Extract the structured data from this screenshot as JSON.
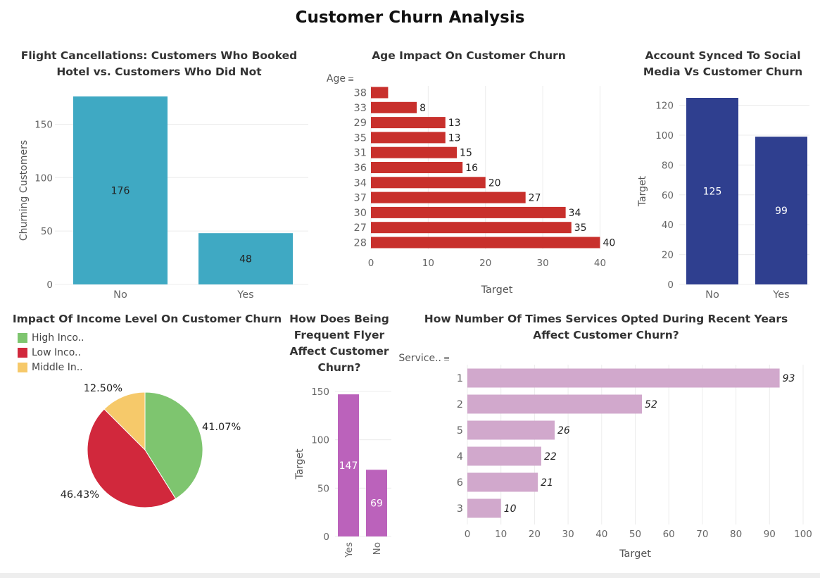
{
  "dashboard": {
    "title": "Customer Churn Analysis"
  },
  "colors": {
    "teal": "#3fa9c3",
    "red": "#c8302c",
    "navy": "#2f3f8f",
    "purple": "#bb62bb",
    "lilac": "#d1a8cc",
    "pie_green": "#7ec56f",
    "pie_red": "#d1283c",
    "pie_yellow": "#f6c96a",
    "grid": "#ececec"
  },
  "chart_data": [
    {
      "id": "hotel",
      "type": "bar",
      "title": "Flight Cancellations: Customers Who Booked Hotel vs. Customers Who Did Not",
      "xlabel": "",
      "ylabel": "Churning Customers",
      "categories": [
        "No",
        "Yes"
      ],
      "values": [
        176,
        48
      ],
      "value_labels": [
        "176",
        "48"
      ],
      "ylim": [
        0,
        176
      ],
      "yticks": [
        0,
        50,
        100,
        150
      ],
      "ytick_labels": [
        "0",
        "50",
        "100",
        "150"
      ],
      "grid": true
    },
    {
      "id": "age",
      "type": "bar",
      "orientation": "horizontal",
      "title": "Age Impact On Customer Churn",
      "ylabel": "Age",
      "xlabel": "Target",
      "categories": [
        "38",
        "33",
        "29",
        "35",
        "31",
        "36",
        "34",
        "37",
        "30",
        "27",
        "28"
      ],
      "values": [
        3,
        8,
        13,
        13,
        15,
        16,
        20,
        27,
        34,
        35,
        40
      ],
      "value_labels": [
        "",
        "8",
        "13",
        "13",
        "15",
        "16",
        "20",
        "27",
        "34",
        "35",
        "40"
      ],
      "xlim": [
        0,
        44
      ],
      "xticks": [
        0,
        10,
        20,
        30,
        40
      ],
      "xtick_labels": [
        "0",
        "10",
        "20",
        "30",
        "40"
      ],
      "grid": true
    },
    {
      "id": "social",
      "type": "bar",
      "title": "Account Synced To Social Media Vs Customer Churn",
      "xlabel": "",
      "ylabel": "Target",
      "categories": [
        "No",
        "Yes"
      ],
      "values": [
        125,
        99
      ],
      "value_labels": [
        "125",
        "99"
      ],
      "ylim": [
        0,
        125
      ],
      "yticks": [
        0,
        20,
        40,
        60,
        80,
        100,
        120
      ],
      "ytick_labels": [
        "0",
        "20",
        "40",
        "60",
        "80",
        "100",
        "120"
      ],
      "grid": true
    },
    {
      "id": "income",
      "type": "pie",
      "title": "Impact Of Income Level On Customer Churn",
      "legend_position": "top-left",
      "legend": [
        "High Inco..",
        "Low Inco..",
        "Middle In.."
      ],
      "values": [
        41.07,
        46.43,
        12.5
      ],
      "value_labels": [
        "41.07%",
        "46.43%",
        "12.50%"
      ]
    },
    {
      "id": "flyer",
      "type": "bar",
      "title": "How Does Being Frequent Flyer Affect Customer Churn?",
      "xlabel": "",
      "ylabel": "Target",
      "categories": [
        "Yes",
        "No"
      ],
      "values": [
        147,
        69
      ],
      "value_labels": [
        "147",
        "69"
      ],
      "ylim": [
        0,
        150
      ],
      "yticks": [
        0,
        50,
        100,
        150
      ],
      "ytick_labels": [
        "0",
        "50",
        "100",
        "150"
      ],
      "grid": true
    },
    {
      "id": "services",
      "type": "bar",
      "orientation": "horizontal",
      "title": "How Number Of Times Services Opted During Recent Years Affect Customer Churn?",
      "ylabel": "Service..",
      "xlabel": "Target",
      "categories": [
        "1",
        "2",
        "5",
        "4",
        "6",
        "3"
      ],
      "values": [
        93,
        52,
        26,
        22,
        21,
        10
      ],
      "value_labels": [
        "93",
        "52",
        "26",
        "22",
        "21",
        "10"
      ],
      "xlim": [
        0,
        100
      ],
      "xticks": [
        0,
        10,
        20,
        30,
        40,
        50,
        60,
        70,
        80,
        90,
        100
      ],
      "xtick_labels": [
        "0",
        "10",
        "20",
        "30",
        "40",
        "50",
        "60",
        "70",
        "80",
        "90",
        "100"
      ],
      "grid": true
    }
  ]
}
